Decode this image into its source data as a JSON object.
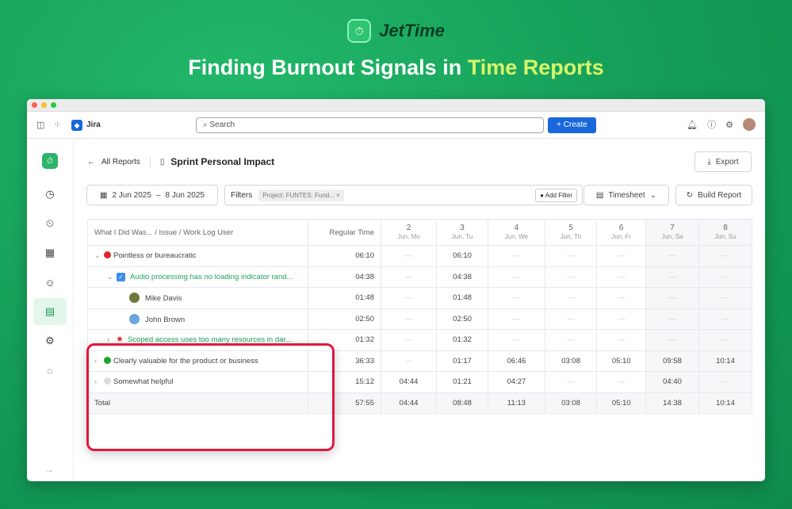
{
  "brand": {
    "name": "JetTime",
    "headline_a": "Finding Burnout Signals in ",
    "headline_b": "Time Reports"
  },
  "jira": {
    "app": "Jira",
    "search_placeholder": "Search",
    "create": "+ Create"
  },
  "page": {
    "back": "All Reports",
    "title": "Sprint Personal Impact",
    "export": "Export",
    "date_from": "2 Jun 2025",
    "date_sep": "–",
    "date_to": "8 Jun 2025",
    "filters_label": "Filters",
    "filter_chip": "Project: FUNTES: Fund...",
    "add_filter": "Add Filter",
    "timesheet": "Timesheet",
    "build": "Build Report"
  },
  "table": {
    "col_name": "What I Did Was... / Issue / Work Log User",
    "col_regular": "Regular Time",
    "days": [
      {
        "d": "2",
        "s": "Jun, Mo"
      },
      {
        "d": "3",
        "s": "Jun, Tu"
      },
      {
        "d": "4",
        "s": "Jun, We"
      },
      {
        "d": "5",
        "s": "Jun, Th"
      },
      {
        "d": "6",
        "s": "Jun, Fr"
      },
      {
        "d": "7",
        "s": "Jun, Sa"
      },
      {
        "d": "8",
        "s": "Jun, Su"
      }
    ],
    "rows": [
      {
        "label": "Pointless or bureaucratic",
        "kind": "group",
        "color": "#e0262b",
        "chev": "⌄",
        "regular": "06:10",
        "days": [
          "—",
          "06:10",
          "—",
          "—",
          "—",
          "—",
          "—"
        ]
      },
      {
        "label": "Audio processing has no loading indicator rand...",
        "kind": "task",
        "chev": "⌄",
        "regular": "04:38",
        "days": [
          "—",
          "04:38",
          "—",
          "—",
          "—",
          "—",
          "—"
        ]
      },
      {
        "label": "Mike Davis",
        "kind": "user",
        "color": "#6b7a3a",
        "regular": "01:48",
        "days": [
          "—",
          "01:48",
          "—",
          "—",
          "—",
          "—",
          "—"
        ]
      },
      {
        "label": "John Brown",
        "kind": "user",
        "color": "#6aa5dd",
        "regular": "02:50",
        "days": [
          "—",
          "02:50",
          "—",
          "—",
          "—",
          "—",
          "—"
        ]
      },
      {
        "label": "Scoped access uses too many resources in dar...",
        "kind": "bug",
        "chev": "›",
        "regular": "01:32",
        "days": [
          "—",
          "01:32",
          "—",
          "—",
          "—",
          "—",
          "—"
        ]
      },
      {
        "label": "Clearly valuable for the product or business",
        "kind": "group",
        "color": "#1ca52a",
        "chev": "›",
        "regular": "36:33",
        "days": [
          "—",
          "01:17",
          "06:46",
          "03:08",
          "05:10",
          "09:58",
          "10:14"
        ]
      },
      {
        "label": "Somewhat helpful",
        "kind": "group",
        "color": "#dddddd",
        "chev": "›",
        "regular": "15:12",
        "days": [
          "04:44",
          "01:21",
          "04:27",
          "—",
          "—",
          "04:40",
          "—"
        ]
      }
    ],
    "total": {
      "label": "Total",
      "regular": "57:55",
      "days": [
        "04:44",
        "08:48",
        "11:13",
        "03:08",
        "05:10",
        "14:38",
        "10:14"
      ]
    }
  }
}
